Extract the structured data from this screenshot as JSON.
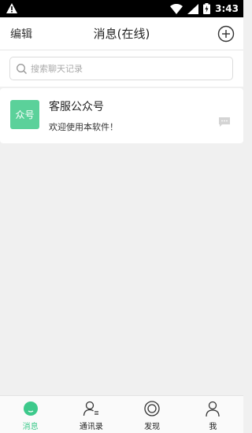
{
  "statusbar": {
    "time": "3:43"
  },
  "header": {
    "edit_label": "编辑",
    "title": "消息(在线)"
  },
  "search": {
    "placeholder": "搜索聊天记录"
  },
  "chats": [
    {
      "avatar_text": "众号",
      "name": "客服公众号",
      "preview": "欢迎使用本软件！"
    }
  ],
  "tabs": [
    {
      "label": "消息",
      "icon": "chat-bubble-icon",
      "active": true
    },
    {
      "label": "通讯录",
      "icon": "contacts-icon",
      "active": false
    },
    {
      "label": "发现",
      "icon": "discover-icon",
      "active": false
    },
    {
      "label": "我",
      "icon": "profile-icon",
      "active": false
    }
  ],
  "colors": {
    "accent": "#3dc98b",
    "avatar_bg": "#5bd19a",
    "statusbar_bg": "#000000"
  }
}
